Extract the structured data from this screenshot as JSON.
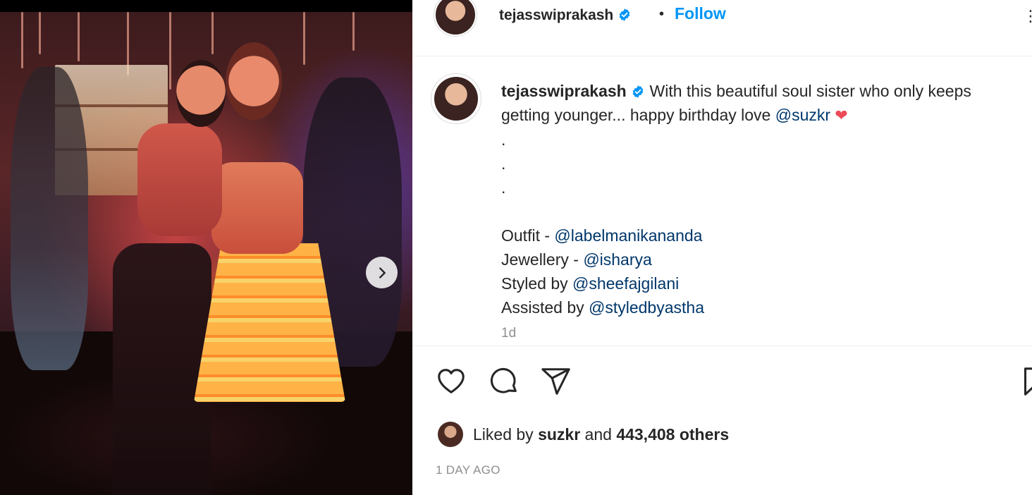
{
  "post": {
    "username": "tejasswiprakash",
    "follow_label": "Follow",
    "header_separator": "•",
    "more_label": "⋮",
    "caption": {
      "username": "tejasswiprakash",
      "line1": "With this beautiful soul sister who only keeps",
      "line2_text": "getting younger... happy birthday love",
      "line2_mention": "@suzkr",
      "heart": "❤",
      "dot1": ".",
      "dot2": ".",
      "dot3": ".",
      "credits": [
        {
          "prefix": "Outfit - ",
          "mention": "@labelmanikananda"
        },
        {
          "prefix": "Jewellery - ",
          "mention": "@isharya"
        },
        {
          "prefix": "Styled by ",
          "mention": "@sheefajgilani"
        },
        {
          "prefix": "Assisted by ",
          "mention": "@styledbyastha"
        }
      ],
      "time": "1d"
    },
    "likes": {
      "prefix": "Liked by",
      "user": "suzkr",
      "conjunction": "and",
      "count_text": "443,408 others"
    },
    "posted_ago": "1 DAY AGO"
  },
  "icons": {
    "like": "heart-icon",
    "comment": "comment-icon",
    "share": "share-icon",
    "save": "bookmark-icon",
    "next": "chevron-right-icon",
    "verified": "verified-badge-icon"
  },
  "colors": {
    "link_blue": "#0095f6",
    "mention": "#00376b",
    "verified": "#0095f6",
    "heart": "#ed4956",
    "muted": "#8e8e8e"
  }
}
